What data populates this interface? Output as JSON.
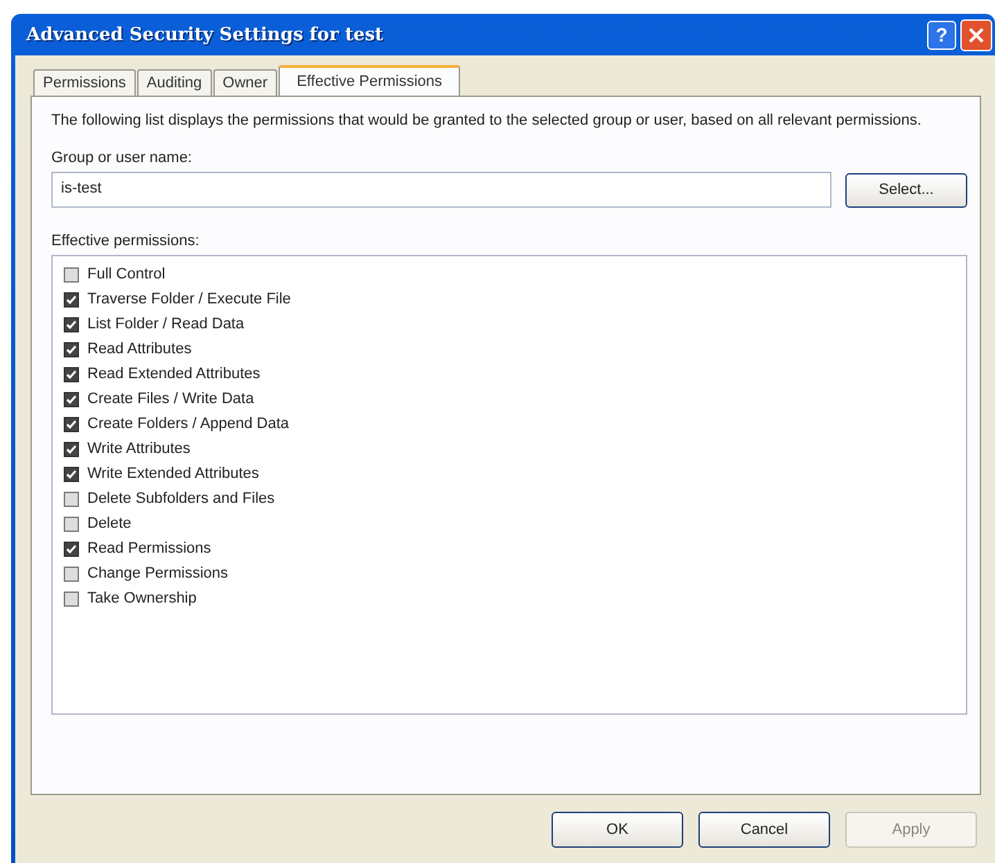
{
  "window": {
    "title": "Advanced Security Settings for test",
    "help_button": "?"
  },
  "tabs": [
    {
      "label": "Permissions",
      "selected": false
    },
    {
      "label": "Auditing",
      "selected": false
    },
    {
      "label": "Owner",
      "selected": false
    },
    {
      "label": "Effective Permissions",
      "selected": true
    }
  ],
  "description": "The following list displays the permissions that would be granted to the selected group or user, based on all relevant permissions.",
  "user_field": {
    "label": "Group or user name:",
    "value": "is-test"
  },
  "select_button": "Select...",
  "permissions_label": "Effective permissions:",
  "permissions": [
    {
      "label": "Full Control",
      "checked": false
    },
    {
      "label": "Traverse Folder / Execute File",
      "checked": true
    },
    {
      "label": "List Folder / Read Data",
      "checked": true
    },
    {
      "label": "Read Attributes",
      "checked": true
    },
    {
      "label": "Read Extended Attributes",
      "checked": true
    },
    {
      "label": "Create Files / Write Data",
      "checked": true
    },
    {
      "label": "Create Folders / Append Data",
      "checked": true
    },
    {
      "label": "Write Attributes",
      "checked": true
    },
    {
      "label": "Write Extended Attributes",
      "checked": true
    },
    {
      "label": "Delete Subfolders and Files",
      "checked": false
    },
    {
      "label": "Delete",
      "checked": false
    },
    {
      "label": "Read Permissions",
      "checked": true
    },
    {
      "label": "Change Permissions",
      "checked": false
    },
    {
      "label": "Take Ownership",
      "checked": false
    }
  ],
  "buttons": [
    {
      "label": "OK",
      "disabled": false
    },
    {
      "label": "Cancel",
      "disabled": false
    },
    {
      "label": "Apply",
      "disabled": true
    }
  ]
}
